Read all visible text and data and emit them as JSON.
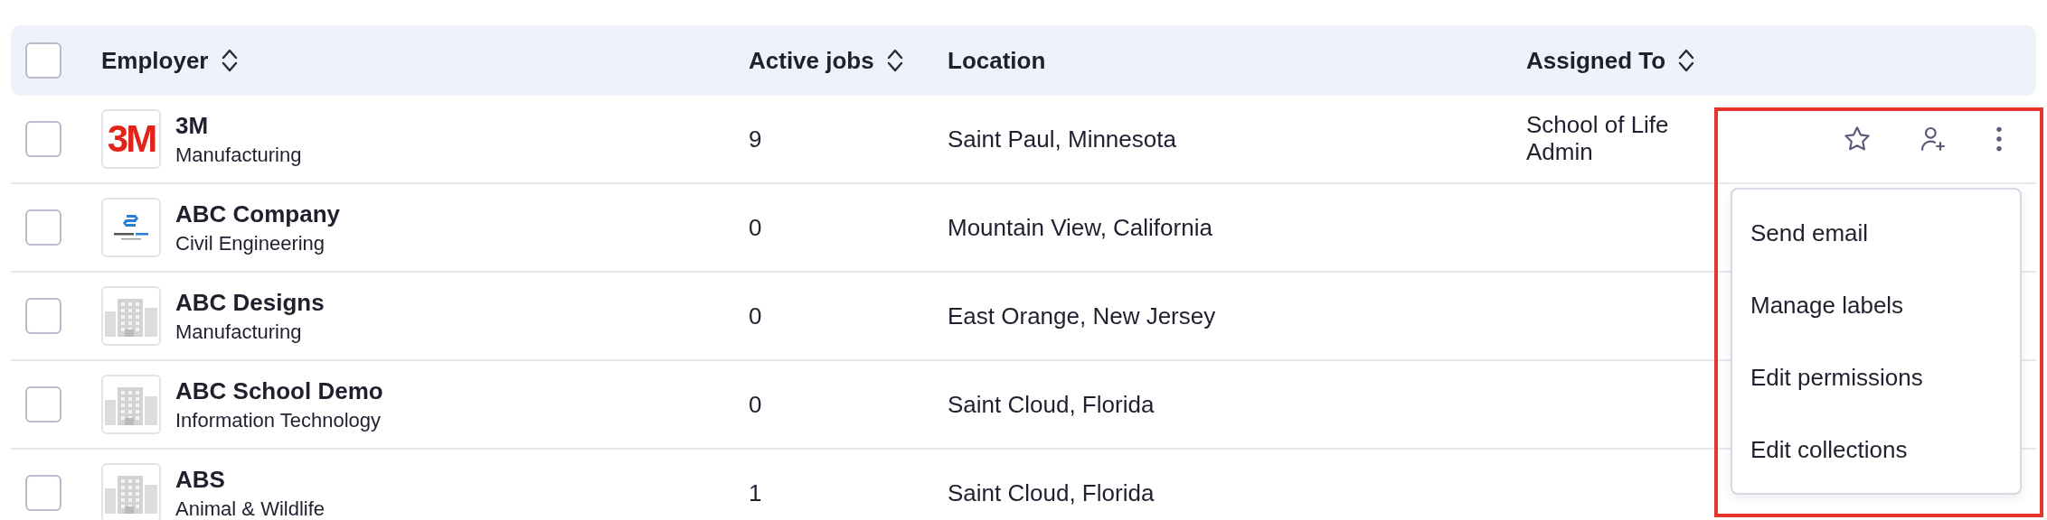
{
  "table": {
    "select_all": {
      "checked": false
    },
    "columns": [
      {
        "label": "Employer",
        "sortable": true
      },
      {
        "label": "Active jobs",
        "sortable": true
      },
      {
        "label": "Location",
        "sortable": false
      },
      {
        "label": "Assigned To",
        "sortable": true
      }
    ],
    "rows": [
      {
        "checked": false,
        "logo": {
          "kind": "wordmark",
          "text": "3M"
        },
        "name": "3M",
        "industry": "Manufacturing",
        "active_jobs": "9",
        "location": "Saint Paul, Minnesota",
        "assigned_to": "School of Life Admin",
        "actions": true
      },
      {
        "checked": false,
        "logo": {
          "kind": "company"
        },
        "name": "ABC Company",
        "industry": "Civil Engineering",
        "active_jobs": "0",
        "location": "Mountain View, California",
        "assigned_to": "",
        "actions": false
      },
      {
        "checked": false,
        "logo": {
          "kind": "building"
        },
        "name": "ABC Designs",
        "industry": "Manufacturing",
        "active_jobs": "0",
        "location": "East Orange, New Jersey",
        "assigned_to": "",
        "actions": false
      },
      {
        "checked": false,
        "logo": {
          "kind": "building"
        },
        "name": "ABC School Demo",
        "industry": "Information Technology",
        "active_jobs": "0",
        "location": "Saint Cloud, Florida",
        "assigned_to": "",
        "actions": false
      },
      {
        "checked": false,
        "logo": {
          "kind": "building"
        },
        "name": "ABS",
        "industry": "Animal & Wildlife",
        "active_jobs": "1",
        "location": "Saint Cloud, Florida",
        "assigned_to": "",
        "actions": false
      }
    ]
  },
  "row_menu": {
    "items": [
      "Send email",
      "Manage labels",
      "Edit permissions",
      "Edit collections"
    ]
  },
  "highlight": true
}
